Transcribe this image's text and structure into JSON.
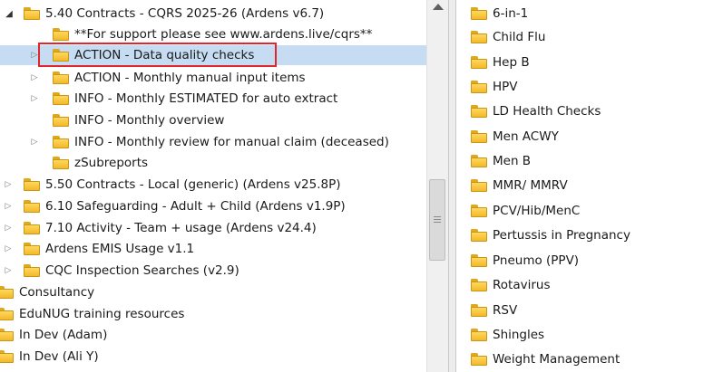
{
  "left_tree": {
    "items": [
      {
        "label": "5.40 Contracts - CQRS 2025-26 (Ardens v6.7)",
        "expander": "open"
      },
      {
        "label": "**For support please see www.ardens.live/cqrs**",
        "expander": "none"
      },
      {
        "label": "ACTION - Data quality checks",
        "expander": "closed",
        "selected": true
      },
      {
        "label": "ACTION - Monthly manual input items",
        "expander": "closed"
      },
      {
        "label": "INFO - Monthly ESTIMATED for auto extract",
        "expander": "closed"
      },
      {
        "label": "INFO - Monthly overview",
        "expander": "none"
      },
      {
        "label": "INFO - Monthly review for manual claim (deceased)",
        "expander": "closed"
      },
      {
        "label": "zSubreports",
        "expander": "none"
      },
      {
        "label": "5.50 Contracts - Local (generic) (Ardens v25.8P)",
        "expander": "closed"
      },
      {
        "label": "6.10 Safeguarding - Adult + Child (Ardens v1.9P)",
        "expander": "closed"
      },
      {
        "label": "7.10 Activity - Team + usage (Ardens v24.4)",
        "expander": "closed"
      },
      {
        "label": "Ardens EMIS Usage v1.1",
        "expander": "closed"
      },
      {
        "label": "CQC Inspection Searches (v2.9)",
        "expander": "closed"
      },
      {
        "label": "Consultancy",
        "expander": "none"
      },
      {
        "label": "EduNUG training resources",
        "expander": "none"
      },
      {
        "label": "In Dev (Adam)",
        "expander": "none"
      },
      {
        "label": "In Dev (Ali Y)",
        "expander": "none"
      }
    ]
  },
  "right_list": {
    "items": [
      "6-in-1",
      "Child Flu",
      "Hep B",
      "HPV",
      "LD Health Checks",
      "Men ACWY",
      "Men B",
      "MMR/ MMRV",
      "PCV/Hib/MenC",
      "Pertussis in Pregnancy",
      "Pneumo (PPV)",
      "Rotavirus",
      "RSV",
      "Shingles",
      "Weight Management"
    ]
  },
  "colors": {
    "selection": "#c6dcf2",
    "highlight_border": "#e0262b",
    "folder_fill": "#f2b92a"
  },
  "icons": {
    "folder": "folder-icon",
    "expand": "chevron-right-icon",
    "collapse": "chevron-down-icon",
    "scroll_up": "arrow-up-icon"
  }
}
